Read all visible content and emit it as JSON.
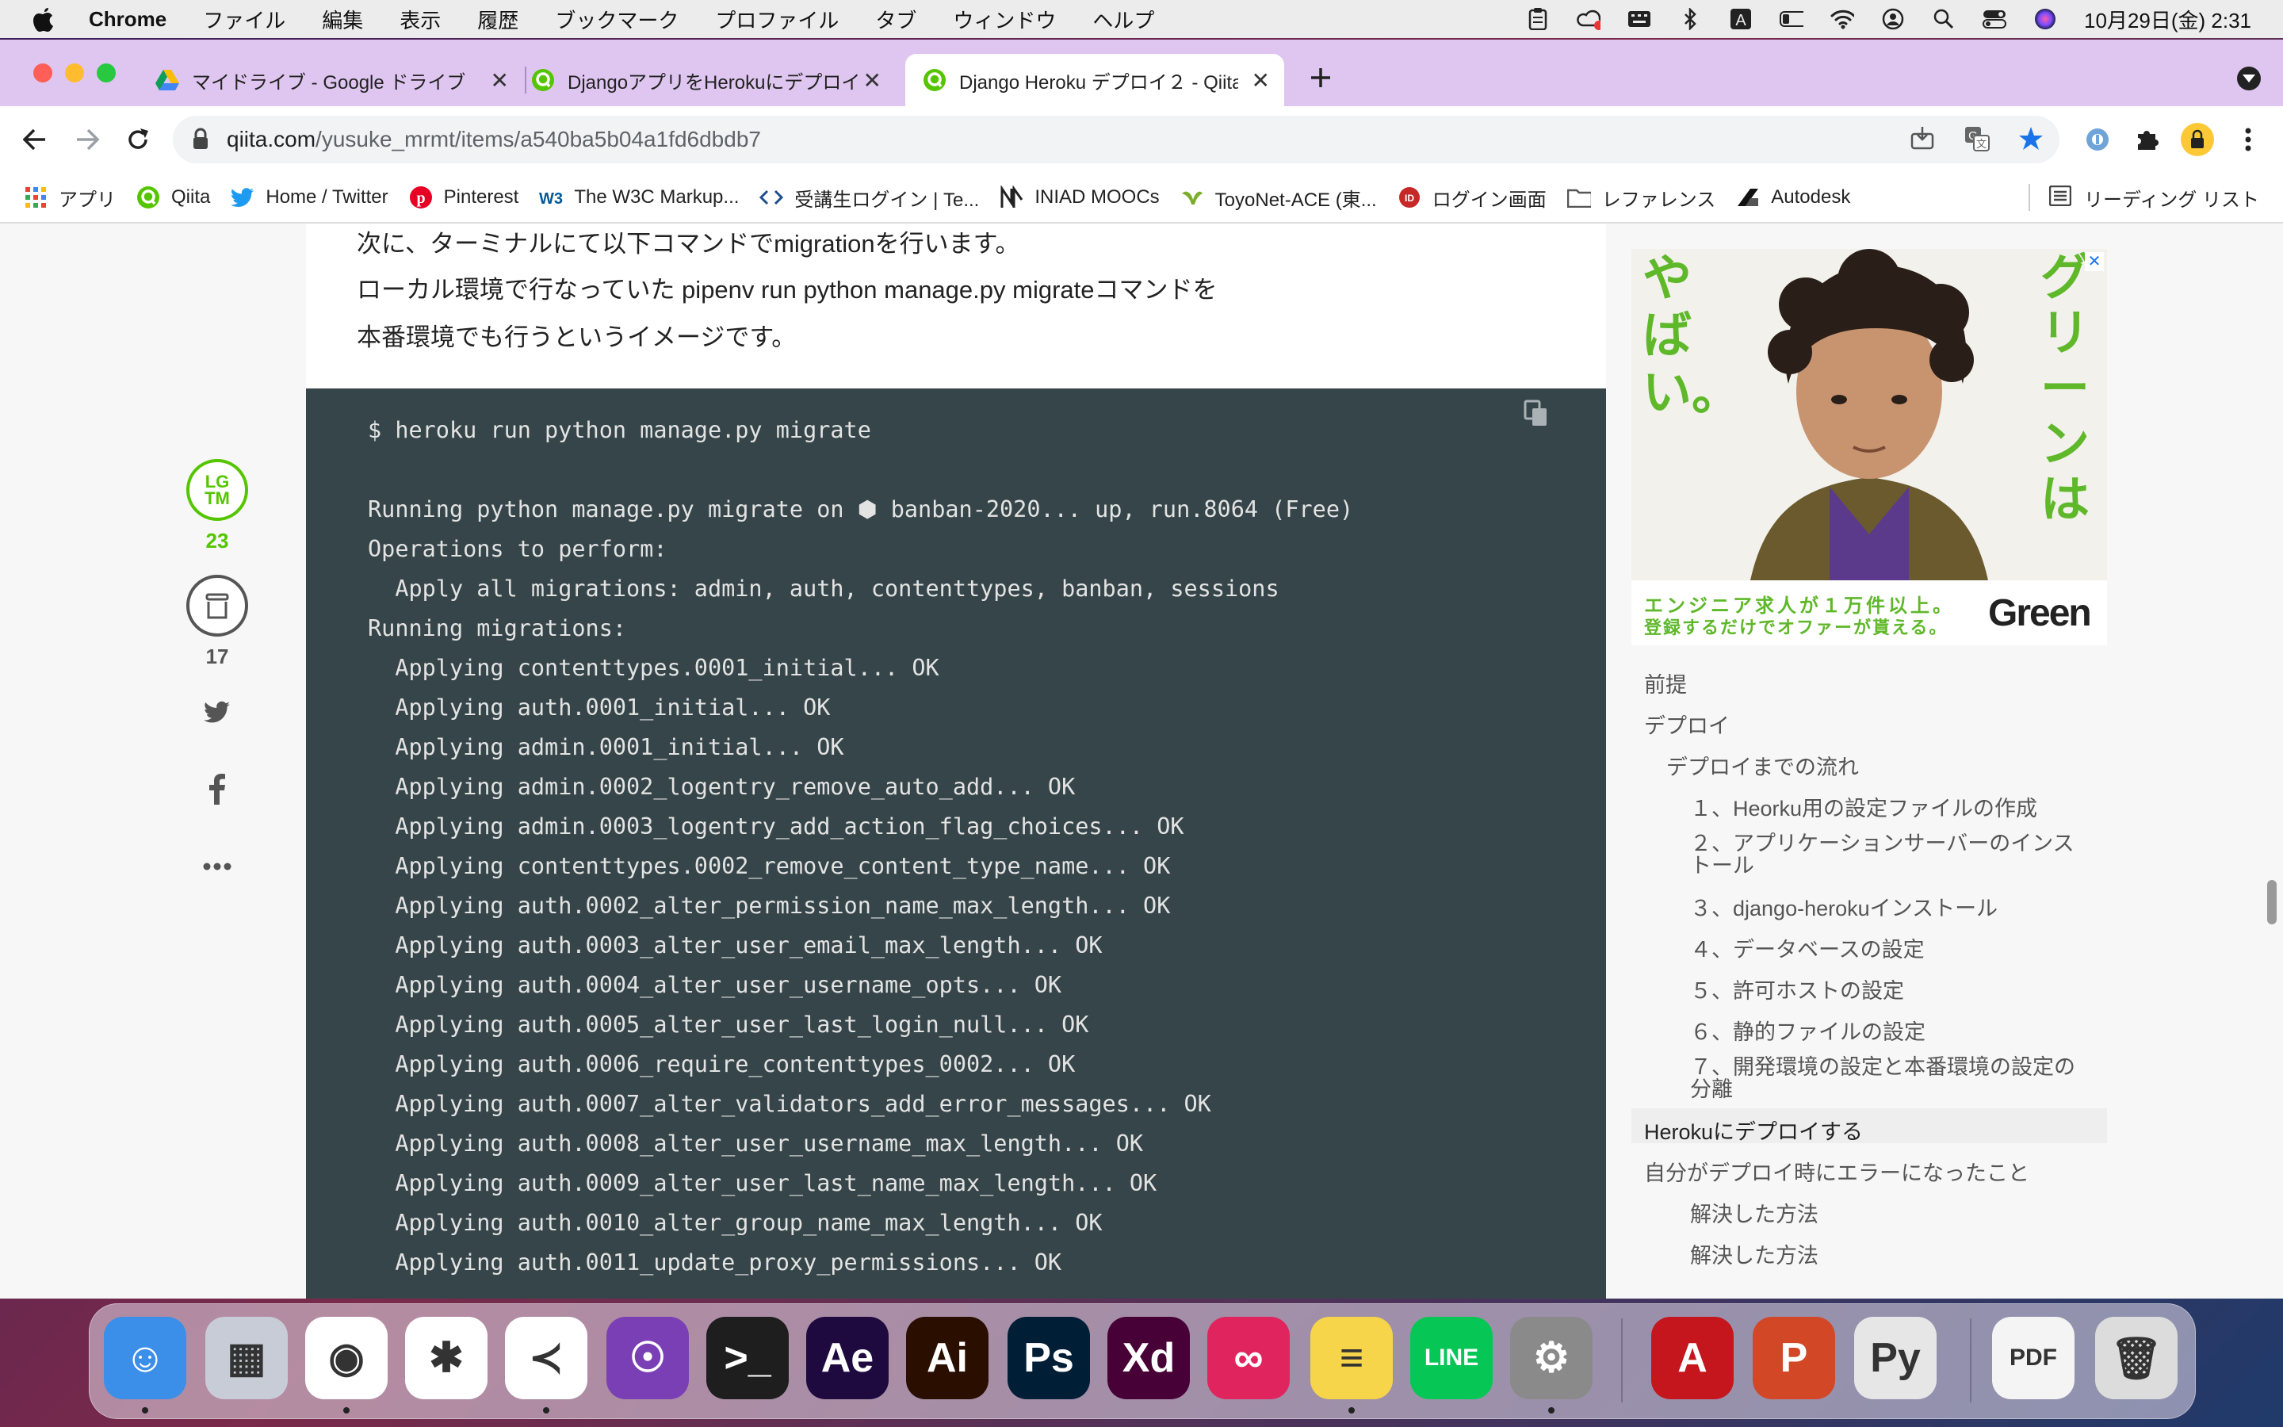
{
  "menubar": {
    "app_name": "Chrome",
    "items": [
      "ファイル",
      "編集",
      "表示",
      "履歴",
      "ブックマーク",
      "プロファイル",
      "タブ",
      "ウィンドウ",
      "ヘルプ"
    ],
    "clock": "10月29日(金)  2:31"
  },
  "tabs": [
    {
      "title": "マイドライブ - Google ドライブ",
      "icon": "google-drive-icon"
    },
    {
      "title": "DjangoアプリをHerokuにデプロイ",
      "icon": "qiita-icon"
    },
    {
      "title": "Django Heroku デプロイ２ - Qiita",
      "icon": "qiita-icon"
    }
  ],
  "url": {
    "host": "qiita.com",
    "path": "/yusuke_mrmt/items/a540ba5b04a1fd6dbdb7"
  },
  "bookmarks": [
    {
      "label": "アプリ",
      "icon": "apps-grid-icon"
    },
    {
      "label": "Qiita",
      "icon": "qiita-icon"
    },
    {
      "label": "Home / Twitter",
      "icon": "twitter-icon"
    },
    {
      "label": "Pinterest",
      "icon": "pinterest-icon"
    },
    {
      "label": "The W3C Markup...",
      "icon": "w3c-icon"
    },
    {
      "label": "受講生ログイン | Te...",
      "icon": "code-icon"
    },
    {
      "label": "INIAD MOOCs",
      "icon": "iniad-icon"
    },
    {
      "label": "ToyoNet-ACE (東...",
      "icon": "toyonet-icon"
    },
    {
      "label": "ログイン画面",
      "icon": "login-icon"
    },
    {
      "label": "レファレンス",
      "icon": "folder-icon"
    },
    {
      "label": "Autodesk",
      "icon": "autodesk-icon"
    }
  ],
  "reading_list": "リーディング リスト",
  "article": {
    "paragraphs": [
      "次に、ターミナルにて以下コマンドでmigrationを行います。",
      "ローカル環境で行なっていた pipenv run python manage.py migrateコマンドを",
      "本番環境でも行うというイメージです。"
    ],
    "code_lines": [
      "$ heroku run python manage.py migrate",
      "",
      "Running python manage.py migrate on ⬢ banban-2020... up, run.8064 (Free)",
      "Operations to perform:",
      "  Apply all migrations: admin, auth, contenttypes, banban, sessions",
      "Running migrations:",
      "  Applying contenttypes.0001_initial... OK",
      "  Applying auth.0001_initial... OK",
      "  Applying admin.0001_initial... OK",
      "  Applying admin.0002_logentry_remove_auto_add... OK",
      "  Applying admin.0003_logentry_add_action_flag_choices... OK",
      "  Applying contenttypes.0002_remove_content_type_name... OK",
      "  Applying auth.0002_alter_permission_name_max_length... OK",
      "  Applying auth.0003_alter_user_email_max_length... OK",
      "  Applying auth.0004_alter_user_username_opts... OK",
      "  Applying auth.0005_alter_user_last_login_null... OK",
      "  Applying auth.0006_require_contenttypes_0002... OK",
      "  Applying auth.0007_alter_validators_add_error_messages... OK",
      "  Applying auth.0008_alter_user_username_max_length... OK",
      "  Applying auth.0009_alter_user_last_name_max_length... OK",
      "  Applying auth.0010_alter_group_name_max_length... OK",
      "  Applying auth.0011_update_proxy_permissions... OK"
    ]
  },
  "side_actions": {
    "lgtm_label": "LG\nTM",
    "lgtm_count": "23",
    "stock_count": "17"
  },
  "ad": {
    "left_text": "やばい。",
    "right_text": "グリーンは",
    "caption_line1": "エンジニア求人が１万件以上。",
    "caption_line2": "登録するだけでオファーが貰える。",
    "brand": "Green",
    "close": "✕"
  },
  "toc": [
    {
      "label": "前提",
      "level": 0,
      "active": false
    },
    {
      "label": "デプロイ",
      "level": 0,
      "active": false
    },
    {
      "label": "デプロイまでの流れ",
      "level": 1,
      "active": false
    },
    {
      "label": "１、Heorku用の設定ファイルの作成",
      "level": 2,
      "active": false
    },
    {
      "label": "２、アプリケーションサーバーのインストール",
      "level": 2,
      "active": false
    },
    {
      "label": "３、django-herokuインストール",
      "level": 2,
      "active": false
    },
    {
      "label": "４、データベースの設定",
      "level": 2,
      "active": false
    },
    {
      "label": "５、許可ホストの設定",
      "level": 2,
      "active": false
    },
    {
      "label": "６、静的ファイルの設定",
      "level": 2,
      "active": false
    },
    {
      "label": "７、開発環境の設定と本番環境の設定の分離",
      "level": 2,
      "active": false
    },
    {
      "label": "Herokuにデプロイする",
      "level": 0,
      "active": true
    },
    {
      "label": "自分がデプロイ時にエラーになったこと",
      "level": 0,
      "active": false
    },
    {
      "label": "解決した方法",
      "level": 2,
      "active": false
    },
    {
      "label": "解決した方法",
      "level": 2,
      "active": false
    }
  ],
  "dock": [
    {
      "name": "finder-icon",
      "glyph": "☺",
      "bg": "#3b8fe8"
    },
    {
      "name": "launchpad-icon",
      "glyph": "▦",
      "bg": "#c8ccd6"
    },
    {
      "name": "chrome-icon",
      "glyph": "◉",
      "bg": "#ffffff"
    },
    {
      "name": "slack-icon",
      "glyph": "✱",
      "bg": "#ffffff"
    },
    {
      "name": "vscode-icon",
      "glyph": "≺",
      "bg": "#ffffff"
    },
    {
      "name": "github-desktop-icon",
      "glyph": "☉",
      "bg": "#7a3fb5"
    },
    {
      "name": "terminal-icon",
      "glyph": ">_",
      "bg": "#1e1e1e"
    },
    {
      "name": "after-effects-icon",
      "glyph": "Ae",
      "bg": "#1f0a40"
    },
    {
      "name": "illustrator-icon",
      "glyph": "Ai",
      "bg": "#2a0f00"
    },
    {
      "name": "photoshop-icon",
      "glyph": "Ps",
      "bg": "#001e36"
    },
    {
      "name": "xd-icon",
      "glyph": "Xd",
      "bg": "#470137"
    },
    {
      "name": "creative-cloud-icon",
      "glyph": "∞",
      "bg": "#e0245e"
    },
    {
      "name": "notes-icon",
      "glyph": "≡",
      "bg": "#f7d54a"
    },
    {
      "name": "line-icon",
      "glyph": "LINE",
      "bg": "#06c755"
    },
    {
      "name": "system-preferences-icon",
      "glyph": "⚙",
      "bg": "#8a8a8a"
    },
    {
      "name": "acrobat-icon",
      "glyph": "A",
      "bg": "#c4161c"
    },
    {
      "name": "powerpoint-icon",
      "glyph": "P",
      "bg": "#d24726"
    },
    {
      "name": "python-launcher-icon",
      "glyph": "Py",
      "bg": "#e6e6e6"
    },
    {
      "name": "pdf-document-icon",
      "glyph": "PDF",
      "bg": "#f4f4f4"
    },
    {
      "name": "trash-icon",
      "glyph": "🗑",
      "bg": "#dcdcdc"
    }
  ]
}
